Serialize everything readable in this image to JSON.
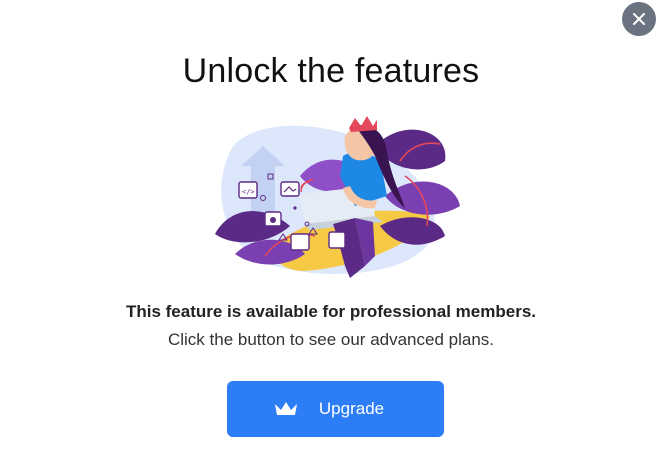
{
  "dialog": {
    "title": "Unlock the features",
    "message_bold": "This feature is available for professional members.",
    "message": "Click the button to see our advanced plans.",
    "upgrade_label": "Upgrade",
    "close_icon": "close-icon",
    "upgrade_icon": "crown-icon"
  },
  "colors": {
    "primary_button": "#2d7df6",
    "close_button": "#6b7280",
    "accent_purple": "#5b2a86",
    "accent_yellow": "#f6c945",
    "accent_blue": "#1e88e5"
  }
}
